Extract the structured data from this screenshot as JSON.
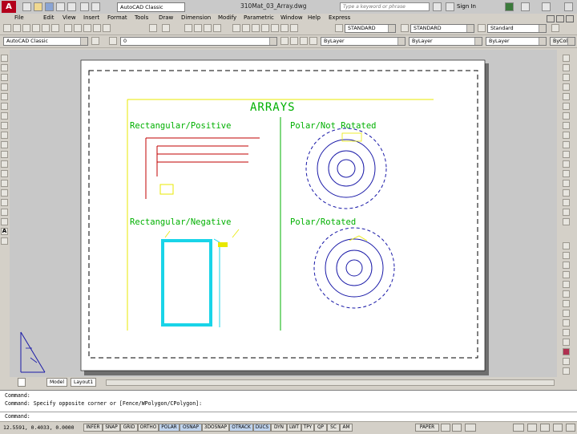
{
  "title": {
    "workspace": "AutoCAD Classic",
    "document": "310Mat_03_Array.dwg",
    "search_placeholder": "Type a keyword or phrase",
    "sign_in": "Sign In"
  },
  "menu": [
    "File",
    "Edit",
    "View",
    "Insert",
    "Format",
    "Tools",
    "Draw",
    "Dimension",
    "Modify",
    "Parametric",
    "Window",
    "Help",
    "Express"
  ],
  "styles": {
    "text_style": "STANDARD",
    "dim_style": "STANDARD",
    "table_style": "Standard"
  },
  "layers": {
    "workspace_combo": "AutoCAD Classic",
    "layer": "0",
    "color": "ByLayer",
    "linetype": "ByLayer",
    "lineweight": "ByLayer",
    "plot_style": "ByColor"
  },
  "drawing": {
    "heading": "ARRAYS",
    "q1": "Rectangular/Positive",
    "q2": "Polar/Not Rotated",
    "q3": "Rectangular/Negative",
    "q4": "Polar/Rotated"
  },
  "tabs": [
    "Model",
    "Layout1"
  ],
  "command": {
    "line1": "Command:",
    "line2": "Command: Specify opposite corner or [Fence/WPolygon/CPolygon]:",
    "prompt": "Command:"
  },
  "status": {
    "coords": "12.5591, 0.4033, 0.0000",
    "toggles": [
      "INFER",
      "SNAP",
      "GRID",
      "ORTHO",
      "POLAR",
      "OSNAP",
      "3DOSNAP",
      "OTRACK",
      "DUCS",
      "DYN",
      "LWT",
      "TPY",
      "QP",
      "SC",
      "AM"
    ],
    "paper": "PAPER"
  },
  "colors": {
    "yellow": "#e8e800",
    "green": "#00b000",
    "red": "#c00000",
    "blue": "#1a1aa8",
    "cyan": "#19d4e8"
  }
}
